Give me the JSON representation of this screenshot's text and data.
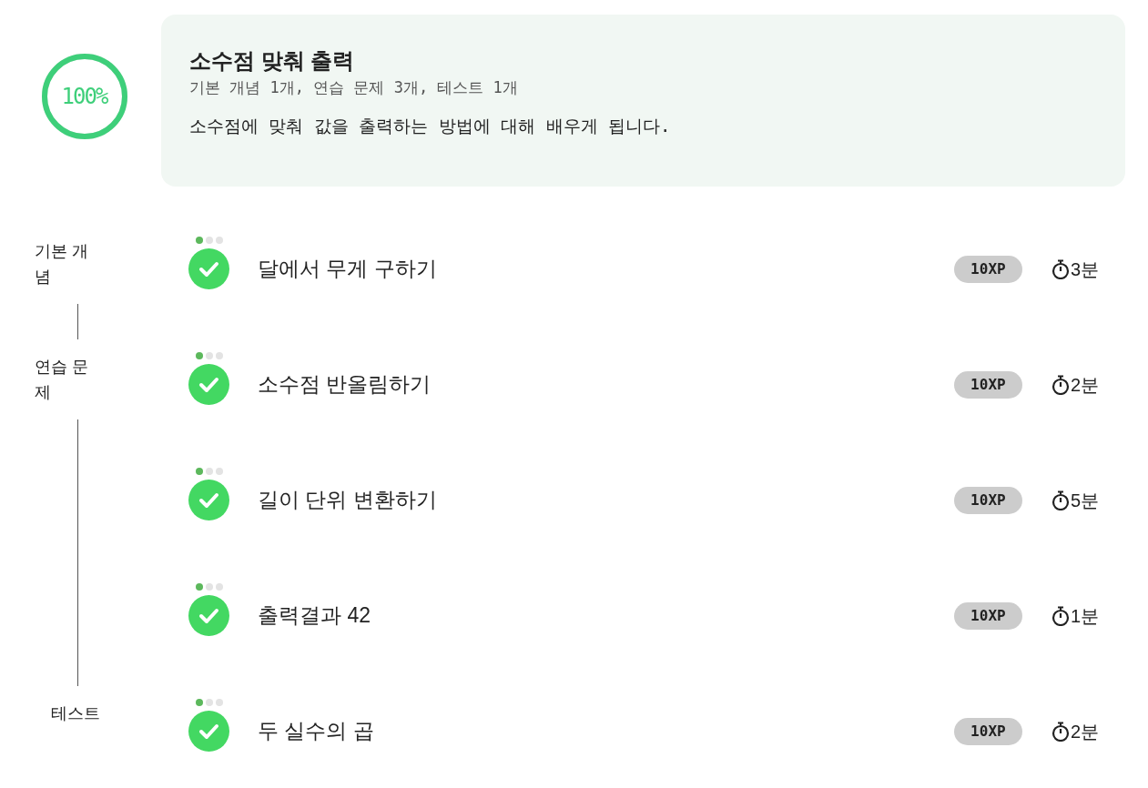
{
  "progress": {
    "level": 1,
    "label": "100%"
  },
  "course": {
    "title": "소수점 맞춰 출력",
    "summary": "기본 개념 1개, 연습 문제 3개, 테스트 1개",
    "description": "소수점에 맞춰 값을 출력하는 방법에 대해 배우게 됩니다."
  },
  "sections": [
    {
      "label": "기본 개념",
      "items": [
        {
          "title": "달에서 무게 구하기",
          "done": true,
          "dots": [
            true,
            false,
            false
          ],
          "xp": "10XP",
          "time": "3분"
        }
      ]
    },
    {
      "label": "연습 문제",
      "items": [
        {
          "title": "소수점 반올림하기",
          "done": true,
          "dots": [
            true,
            false,
            false
          ],
          "xp": "10XP",
          "time": "2분"
        },
        {
          "title": "길이 단위 변환하기",
          "done": true,
          "dots": [
            true,
            false,
            false
          ],
          "xp": "10XP",
          "time": "5분"
        },
        {
          "title": "출력결과 42",
          "done": true,
          "dots": [
            true,
            false,
            false
          ],
          "xp": "10XP",
          "time": "1분"
        }
      ]
    },
    {
      "label": "테스트",
      "items": [
        {
          "title": "두 실수의 곱",
          "done": true,
          "dots": [
            true,
            false,
            false
          ],
          "xp": "10XP",
          "time": "2분"
        }
      ]
    }
  ]
}
